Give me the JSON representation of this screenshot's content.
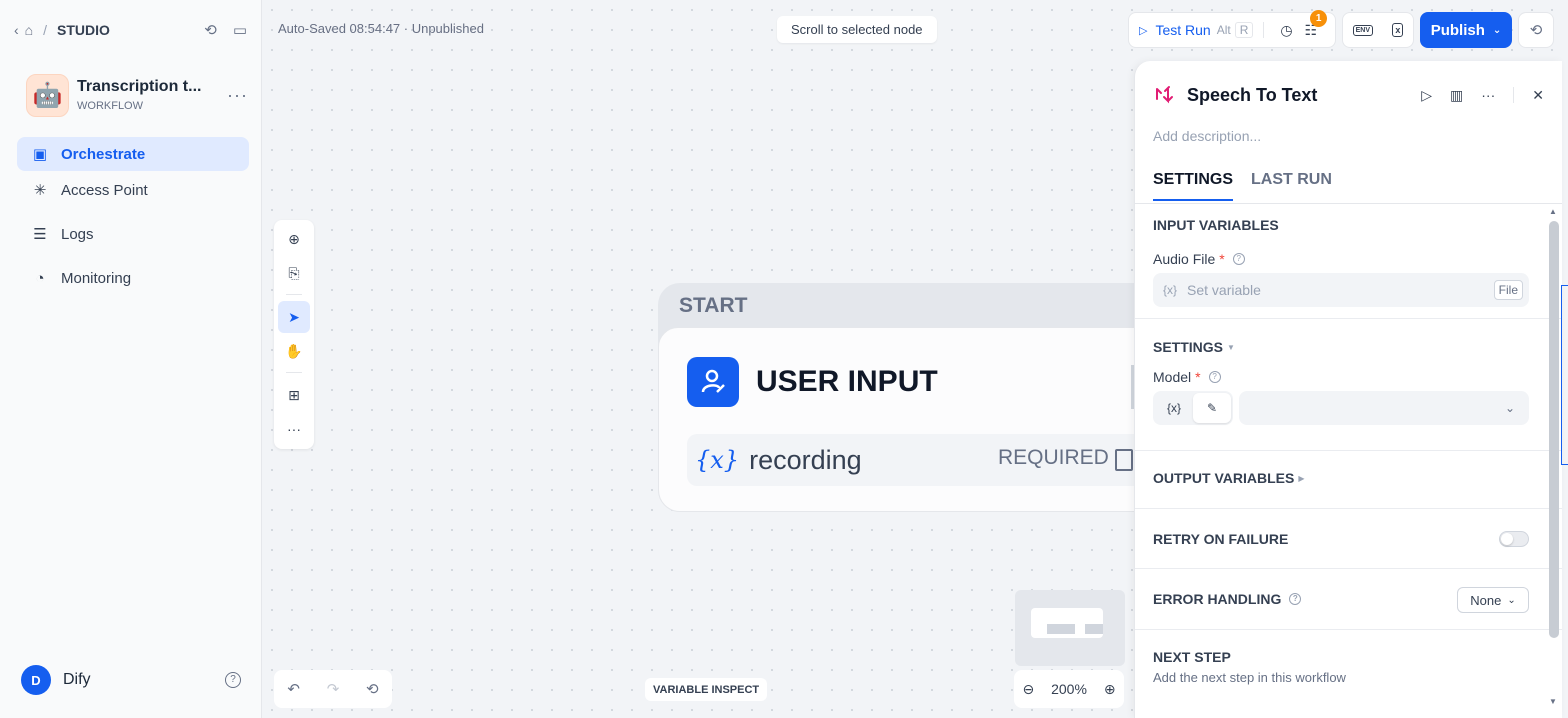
{
  "sidebar": {
    "breadcrumb": "STUDIO",
    "app": {
      "title": "Transcription t...",
      "type": "WORKFLOW"
    },
    "nav": [
      {
        "label": "Orchestrate",
        "icon": "window-icon"
      },
      {
        "label": "Access Point",
        "icon": "sparkle-icon"
      },
      {
        "label": "Logs",
        "icon": "document-icon"
      },
      {
        "label": "Monitoring",
        "icon": "gauge-icon"
      }
    ],
    "user": {
      "initial": "D",
      "name": "Dify"
    }
  },
  "header": {
    "autosave": "Auto-Saved 08:54:47 · Unpublished",
    "scroll_btn": "Scroll to selected node",
    "test_run": "Test Run",
    "shortcut_alt": "Alt",
    "shortcut_key": "R",
    "checklist_badge": "1",
    "env_label": "ENV",
    "publish": "Publish"
  },
  "canvas": {
    "start_label": "START",
    "node_title": "USER INPUT",
    "var_icon": "{x}",
    "var_name": "recording",
    "var_required": "REQUIRED",
    "variable_inspect": "VARIABLE INSPECT",
    "zoom": "200%"
  },
  "panel": {
    "title": "Speech To Text",
    "desc_placeholder": "Add description...",
    "tabs": [
      "SETTINGS",
      "LAST RUN"
    ],
    "input_variables": "INPUT VARIABLES",
    "audio_label": "Audio File",
    "audio_placeholder": "Set variable",
    "audio_type": "File",
    "var_prefix": "{x}",
    "settings": "SETTINGS",
    "model_label": "Model",
    "output_variables": "OUTPUT VARIABLES",
    "retry": "RETRY ON FAILURE",
    "error_handling": "ERROR HANDLING",
    "error_value": "None",
    "next_step": "NEXT STEP",
    "next_desc": "Add the next step in this workflow"
  },
  "colors": {
    "accent": "#155eef",
    "node_icon": "#e11d74",
    "badge": "#f79009"
  }
}
